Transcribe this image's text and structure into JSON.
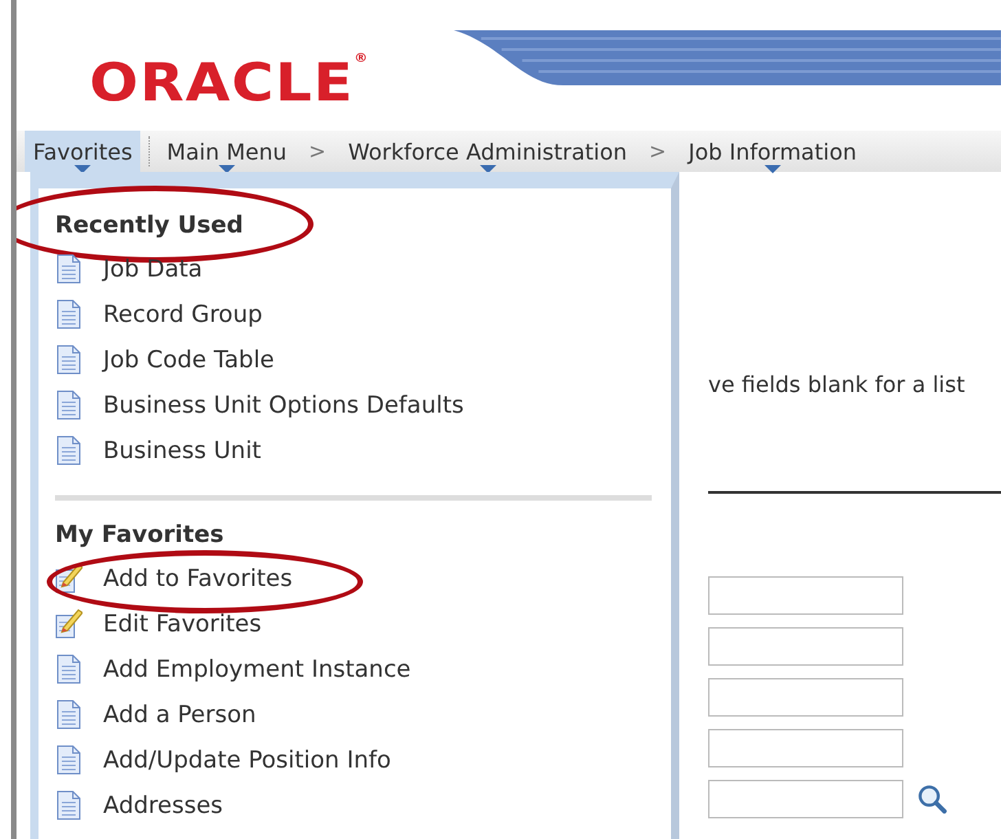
{
  "logo": {
    "text": "ORACLE",
    "mark": "®"
  },
  "nav": [
    {
      "label": "Favorites",
      "selected": true
    },
    {
      "label": "Main Menu",
      "selected": false,
      "separator": ">"
    },
    {
      "label": "Workforce Administration",
      "selected": false,
      "separator": ">"
    },
    {
      "label": "Job Information",
      "selected": false
    }
  ],
  "page": {
    "hint": "ve fields blank for a list",
    "fields": [
      {
        "lookup": false
      },
      {
        "lookup": false
      },
      {
        "lookup": false
      },
      {
        "lookup": false
      },
      {
        "lookup": true
      }
    ]
  },
  "menu": {
    "sections": [
      {
        "title": "Recently Used",
        "circled": true,
        "items": [
          {
            "label": "Job Data",
            "kind": "page",
            "circled": false
          },
          {
            "label": "Record Group",
            "kind": "page",
            "circled": false
          },
          {
            "label": "Job Code Table",
            "kind": "page",
            "circled": false
          },
          {
            "label": "Business Unit Options Defaults",
            "kind": "page",
            "circled": false
          },
          {
            "label": "Business Unit",
            "kind": "page",
            "circled": false
          }
        ]
      },
      {
        "title": "My Favorites",
        "circled": false,
        "items": [
          {
            "label": "Add to Favorites",
            "kind": "edit",
            "circled": true
          },
          {
            "label": "Edit Favorites",
            "kind": "edit",
            "circled": false
          },
          {
            "label": "Add Employment Instance",
            "kind": "page",
            "circled": false
          },
          {
            "label": "Add a Person",
            "kind": "page",
            "circled": false
          },
          {
            "label": "Add/Update Position Info",
            "kind": "page",
            "circled": false
          },
          {
            "label": "Addresses",
            "kind": "page",
            "circled": false
          }
        ]
      }
    ]
  }
}
